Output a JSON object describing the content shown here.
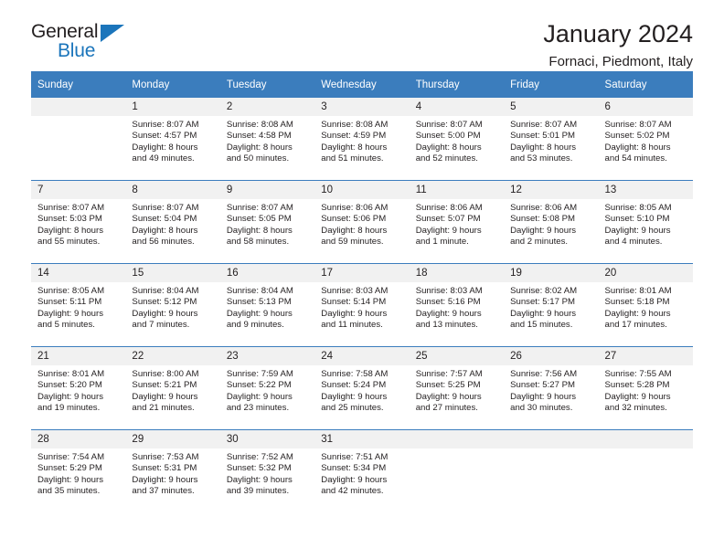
{
  "brand": {
    "name_top": "General",
    "name_bottom": "Blue",
    "accent_color": "#1b75bb"
  },
  "header": {
    "month_title": "January 2024",
    "location": "Fornaci, Piedmont, Italy"
  },
  "calendar": {
    "header_color": "#3b7dbd",
    "weekdays": [
      "Sunday",
      "Monday",
      "Tuesday",
      "Wednesday",
      "Thursday",
      "Friday",
      "Saturday"
    ],
    "weeks": [
      [
        {
          "day": "",
          "lines": []
        },
        {
          "day": "1",
          "lines": [
            "Sunrise: 8:07 AM",
            "Sunset: 4:57 PM",
            "Daylight: 8 hours",
            "and 49 minutes."
          ]
        },
        {
          "day": "2",
          "lines": [
            "Sunrise: 8:08 AM",
            "Sunset: 4:58 PM",
            "Daylight: 8 hours",
            "and 50 minutes."
          ]
        },
        {
          "day": "3",
          "lines": [
            "Sunrise: 8:08 AM",
            "Sunset: 4:59 PM",
            "Daylight: 8 hours",
            "and 51 minutes."
          ]
        },
        {
          "day": "4",
          "lines": [
            "Sunrise: 8:07 AM",
            "Sunset: 5:00 PM",
            "Daylight: 8 hours",
            "and 52 minutes."
          ]
        },
        {
          "day": "5",
          "lines": [
            "Sunrise: 8:07 AM",
            "Sunset: 5:01 PM",
            "Daylight: 8 hours",
            "and 53 minutes."
          ]
        },
        {
          "day": "6",
          "lines": [
            "Sunrise: 8:07 AM",
            "Sunset: 5:02 PM",
            "Daylight: 8 hours",
            "and 54 minutes."
          ]
        }
      ],
      [
        {
          "day": "7",
          "lines": [
            "Sunrise: 8:07 AM",
            "Sunset: 5:03 PM",
            "Daylight: 8 hours",
            "and 55 minutes."
          ]
        },
        {
          "day": "8",
          "lines": [
            "Sunrise: 8:07 AM",
            "Sunset: 5:04 PM",
            "Daylight: 8 hours",
            "and 56 minutes."
          ]
        },
        {
          "day": "9",
          "lines": [
            "Sunrise: 8:07 AM",
            "Sunset: 5:05 PM",
            "Daylight: 8 hours",
            "and 58 minutes."
          ]
        },
        {
          "day": "10",
          "lines": [
            "Sunrise: 8:06 AM",
            "Sunset: 5:06 PM",
            "Daylight: 8 hours",
            "and 59 minutes."
          ]
        },
        {
          "day": "11",
          "lines": [
            "Sunrise: 8:06 AM",
            "Sunset: 5:07 PM",
            "Daylight: 9 hours",
            "and 1 minute."
          ]
        },
        {
          "day": "12",
          "lines": [
            "Sunrise: 8:06 AM",
            "Sunset: 5:08 PM",
            "Daylight: 9 hours",
            "and 2 minutes."
          ]
        },
        {
          "day": "13",
          "lines": [
            "Sunrise: 8:05 AM",
            "Sunset: 5:10 PM",
            "Daylight: 9 hours",
            "and 4 minutes."
          ]
        }
      ],
      [
        {
          "day": "14",
          "lines": [
            "Sunrise: 8:05 AM",
            "Sunset: 5:11 PM",
            "Daylight: 9 hours",
            "and 5 minutes."
          ]
        },
        {
          "day": "15",
          "lines": [
            "Sunrise: 8:04 AM",
            "Sunset: 5:12 PM",
            "Daylight: 9 hours",
            "and 7 minutes."
          ]
        },
        {
          "day": "16",
          "lines": [
            "Sunrise: 8:04 AM",
            "Sunset: 5:13 PM",
            "Daylight: 9 hours",
            "and 9 minutes."
          ]
        },
        {
          "day": "17",
          "lines": [
            "Sunrise: 8:03 AM",
            "Sunset: 5:14 PM",
            "Daylight: 9 hours",
            "and 11 minutes."
          ]
        },
        {
          "day": "18",
          "lines": [
            "Sunrise: 8:03 AM",
            "Sunset: 5:16 PM",
            "Daylight: 9 hours",
            "and 13 minutes."
          ]
        },
        {
          "day": "19",
          "lines": [
            "Sunrise: 8:02 AM",
            "Sunset: 5:17 PM",
            "Daylight: 9 hours",
            "and 15 minutes."
          ]
        },
        {
          "day": "20",
          "lines": [
            "Sunrise: 8:01 AM",
            "Sunset: 5:18 PM",
            "Daylight: 9 hours",
            "and 17 minutes."
          ]
        }
      ],
      [
        {
          "day": "21",
          "lines": [
            "Sunrise: 8:01 AM",
            "Sunset: 5:20 PM",
            "Daylight: 9 hours",
            "and 19 minutes."
          ]
        },
        {
          "day": "22",
          "lines": [
            "Sunrise: 8:00 AM",
            "Sunset: 5:21 PM",
            "Daylight: 9 hours",
            "and 21 minutes."
          ]
        },
        {
          "day": "23",
          "lines": [
            "Sunrise: 7:59 AM",
            "Sunset: 5:22 PM",
            "Daylight: 9 hours",
            "and 23 minutes."
          ]
        },
        {
          "day": "24",
          "lines": [
            "Sunrise: 7:58 AM",
            "Sunset: 5:24 PM",
            "Daylight: 9 hours",
            "and 25 minutes."
          ]
        },
        {
          "day": "25",
          "lines": [
            "Sunrise: 7:57 AM",
            "Sunset: 5:25 PM",
            "Daylight: 9 hours",
            "and 27 minutes."
          ]
        },
        {
          "day": "26",
          "lines": [
            "Sunrise: 7:56 AM",
            "Sunset: 5:27 PM",
            "Daylight: 9 hours",
            "and 30 minutes."
          ]
        },
        {
          "day": "27",
          "lines": [
            "Sunrise: 7:55 AM",
            "Sunset: 5:28 PM",
            "Daylight: 9 hours",
            "and 32 minutes."
          ]
        }
      ],
      [
        {
          "day": "28",
          "lines": [
            "Sunrise: 7:54 AM",
            "Sunset: 5:29 PM",
            "Daylight: 9 hours",
            "and 35 minutes."
          ]
        },
        {
          "day": "29",
          "lines": [
            "Sunrise: 7:53 AM",
            "Sunset: 5:31 PM",
            "Daylight: 9 hours",
            "and 37 minutes."
          ]
        },
        {
          "day": "30",
          "lines": [
            "Sunrise: 7:52 AM",
            "Sunset: 5:32 PM",
            "Daylight: 9 hours",
            "and 39 minutes."
          ]
        },
        {
          "day": "31",
          "lines": [
            "Sunrise: 7:51 AM",
            "Sunset: 5:34 PM",
            "Daylight: 9 hours",
            "and 42 minutes."
          ]
        },
        {
          "day": "",
          "lines": []
        },
        {
          "day": "",
          "lines": []
        },
        {
          "day": "",
          "lines": []
        }
      ]
    ]
  }
}
